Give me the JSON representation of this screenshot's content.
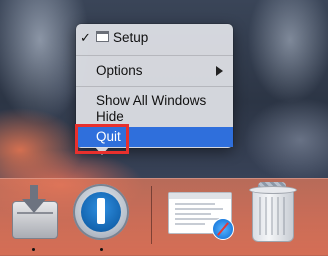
{
  "context_menu": {
    "items": [
      {
        "label": "Setup",
        "checked": true,
        "icon": "window-icon"
      },
      {
        "label": "Options",
        "has_submenu": true
      },
      {
        "label": "Show All Windows"
      },
      {
        "label": "Hide"
      },
      {
        "label": "Quit",
        "selected": true
      }
    ],
    "check_glyph": "✓",
    "highlight_color": "#2f6fdc",
    "callout_color": "#e8302d"
  },
  "dock": {
    "items": [
      {
        "name": "installer",
        "icon": "installer-icon",
        "running": true
      },
      {
        "name": "1password",
        "icon": "1password-icon",
        "running": true
      },
      {
        "name": "safari-window-thumbnail",
        "icon": "safari-icon",
        "running": false
      },
      {
        "name": "trash",
        "icon": "trash-full-icon",
        "running": false
      }
    ]
  }
}
